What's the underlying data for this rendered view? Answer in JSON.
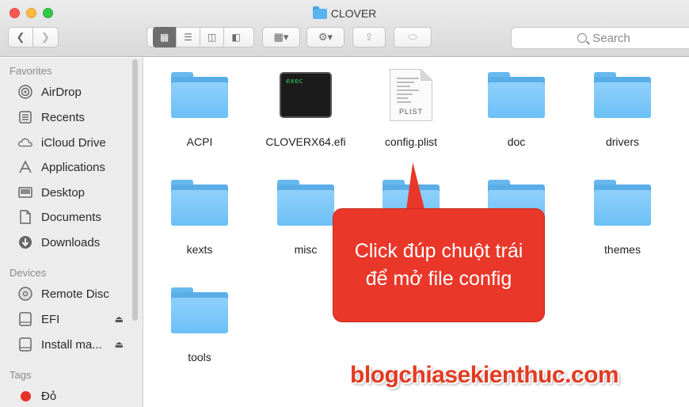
{
  "window": {
    "title": "CLOVER"
  },
  "toolbar": {
    "search_placeholder": "Search"
  },
  "sidebar": {
    "favorites_heading": "Favorites",
    "favorites": [
      {
        "label": "AirDrop",
        "icon": "airdrop-icon"
      },
      {
        "label": "Recents",
        "icon": "recents-icon"
      },
      {
        "label": "iCloud Drive",
        "icon": "cloud-icon"
      },
      {
        "label": "Applications",
        "icon": "applications-icon"
      },
      {
        "label": "Desktop",
        "icon": "desktop-icon"
      },
      {
        "label": "Documents",
        "icon": "documents-icon"
      },
      {
        "label": "Downloads",
        "icon": "downloads-icon"
      }
    ],
    "devices_heading": "Devices",
    "devices": [
      {
        "label": "Remote Disc",
        "icon": "disc-icon"
      },
      {
        "label": "EFI",
        "icon": "drive-icon"
      },
      {
        "label": "Install ma...",
        "icon": "drive-icon"
      }
    ],
    "tags_heading": "Tags",
    "tags": [
      {
        "label": "Đỏ",
        "color": "#e8302a"
      }
    ]
  },
  "files": [
    {
      "name": "ACPI",
      "kind": "folder"
    },
    {
      "name": "CLOVERX64.efi",
      "kind": "exec",
      "badge": "exec"
    },
    {
      "name": "config.plist",
      "kind": "plist",
      "badge": "PLIST"
    },
    {
      "name": "doc",
      "kind": "folder"
    },
    {
      "name": "drivers",
      "kind": "folder"
    },
    {
      "name": "kexts",
      "kind": "folder"
    },
    {
      "name": "misc",
      "kind": "folder"
    },
    {
      "name": "",
      "kind": "folder"
    },
    {
      "name": "",
      "kind": "folder"
    },
    {
      "name": "themes",
      "kind": "folder"
    },
    {
      "name": "tools",
      "kind": "folder"
    }
  ],
  "callout": {
    "text": "Click đúp chuột trái để mở file config",
    "color": "#e9372a"
  },
  "watermark": {
    "text": "blogchiasekienthuc.com",
    "color": "#e23b22"
  }
}
